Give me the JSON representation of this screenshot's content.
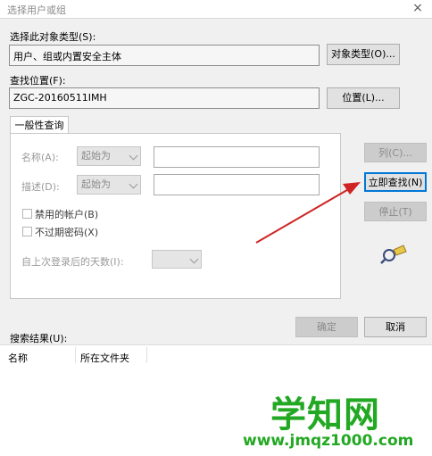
{
  "window": {
    "title": "选择用户或组",
    "close_symbol": "×"
  },
  "object_type": {
    "label": "选择此对象类型(S):",
    "value": "用户、组或内置安全主体",
    "button": "对象类型(O)..."
  },
  "location": {
    "label": "查找位置(F):",
    "value": "ZGC-20160511IMH",
    "button": "位置(L)..."
  },
  "query": {
    "tab_label": "一般性查询",
    "name_label": "名称(A):",
    "name_mode": "起始为",
    "desc_label": "描述(D):",
    "desc_mode": "起始为",
    "disabled_accounts_label": "禁用的帐户(B)",
    "no_expire_pw_label": "不过期密码(X)",
    "days_since_logon_label": "自上次登录后的天数(I):"
  },
  "actions": {
    "columns": "列(C)...",
    "find_now": "立即查找(N)",
    "stop": "停止(T)",
    "ok": "确定",
    "cancel": "取消"
  },
  "results": {
    "label": "搜索结果(U):",
    "columns": [
      "名称",
      "所在文件夹"
    ]
  },
  "watermark": {
    "brand": "学知网",
    "url": "www.jmqz1000.com"
  },
  "colors": {
    "arrow": "#d02424",
    "watermark": "#22a822",
    "focus": "#0078d7"
  }
}
